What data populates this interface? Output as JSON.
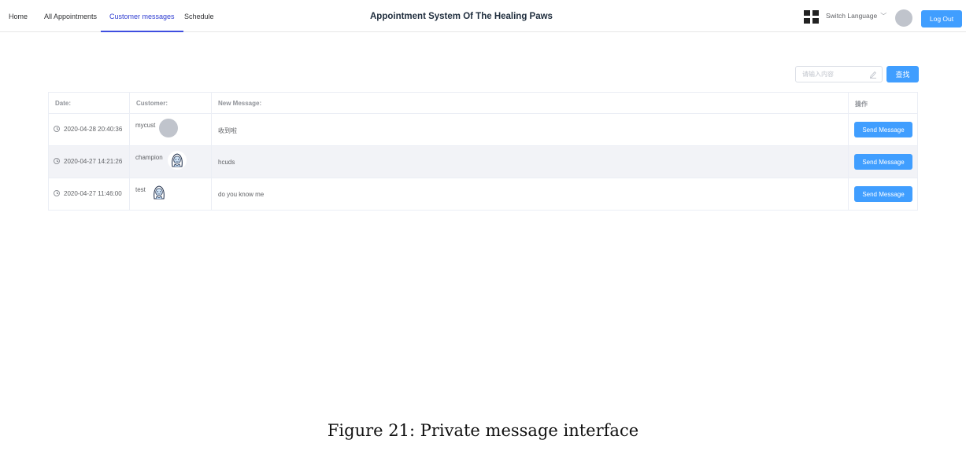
{
  "nav": {
    "home": "Home",
    "all_appointments": "All Appointments",
    "customer_messages": "Customer messages",
    "schedule": "Schedule"
  },
  "header": {
    "title": "Appointment System Of The Healing Paws",
    "switch_language": "Switch Language",
    "logout": "Log Out"
  },
  "search": {
    "placeholder": "请输入内容",
    "button": "查找"
  },
  "table": {
    "columns": [
      "Date:",
      "Customer:",
      "New Message:",
      "操作"
    ],
    "rows": [
      {
        "date": "2020-04-28 20:40:36",
        "customer": "mycust",
        "avatar": "gray-circle",
        "message": "收到啦",
        "action": "Send Message"
      },
      {
        "date": "2020-04-27 14:21:26",
        "customer": "champion",
        "avatar": "cartoon-icon",
        "message": "hcuds",
        "action": "Send Message"
      },
      {
        "date": "2020-04-27 11:46:00",
        "customer": "test",
        "avatar": "cartoon-icon",
        "message": "do you know me",
        "action": "Send Message"
      }
    ]
  },
  "caption": "Figure 21: Private message interface",
  "colors": {
    "primary": "#409eff",
    "active_nav": "#2f3dd1",
    "stripe": "#f2f3f7"
  }
}
